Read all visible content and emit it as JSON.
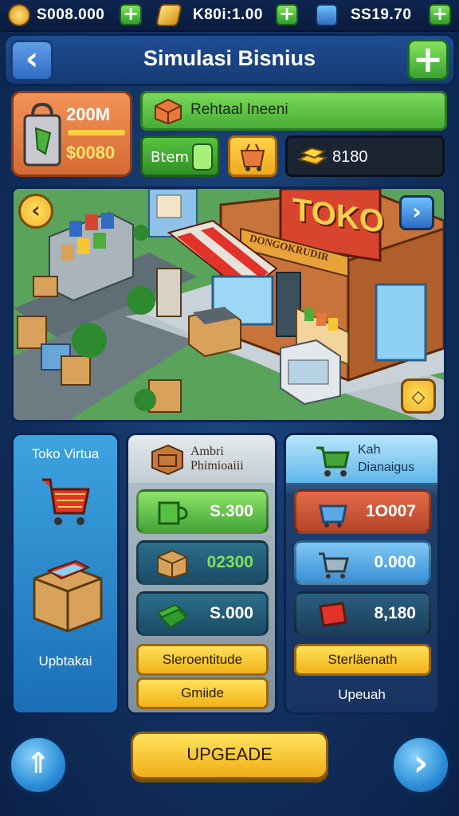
{
  "resources": [
    {
      "icon": "gold-coin-icon",
      "value": "S008.000"
    },
    {
      "icon": "gold-bar-icon",
      "value": "K80i:1.00"
    },
    {
      "icon": "gem-chest-icon",
      "value": "SS19.70"
    }
  ],
  "header": {
    "title": "Simulasi Bisnius"
  },
  "stats": {
    "money_top": "200M",
    "money_bottom": "$0080",
    "banner_text": "Rehtaal Ineeni",
    "chip_label": "Btem",
    "dark_chip_value": "8180"
  },
  "scene": {
    "sign": "TOKO",
    "awning_sign": "DONGOKRUDIR"
  },
  "panel_left": {
    "title": "Toko Virtua",
    "footer": "Upbtakai"
  },
  "panel_mid": {
    "title_line1": "Ambri",
    "title_line2": "Phimioaiii",
    "rows": [
      "S.300",
      "02300",
      "S.000"
    ],
    "button1": "Sleroentitude",
    "button2": "Gmiide"
  },
  "panel_right": {
    "title_line1": "Kah",
    "title_line2": "Dianaigus",
    "rows": [
      "1O007",
      "0.000",
      "8,180"
    ],
    "button1": "Sterläenath",
    "footer": "Upeuah"
  },
  "footer": {
    "upgrade_label": "UPGEADE"
  },
  "colors": {
    "accent_yellow": "#f2b218",
    "accent_green": "#46ad34",
    "panel_blue": "#1b6fb5"
  }
}
